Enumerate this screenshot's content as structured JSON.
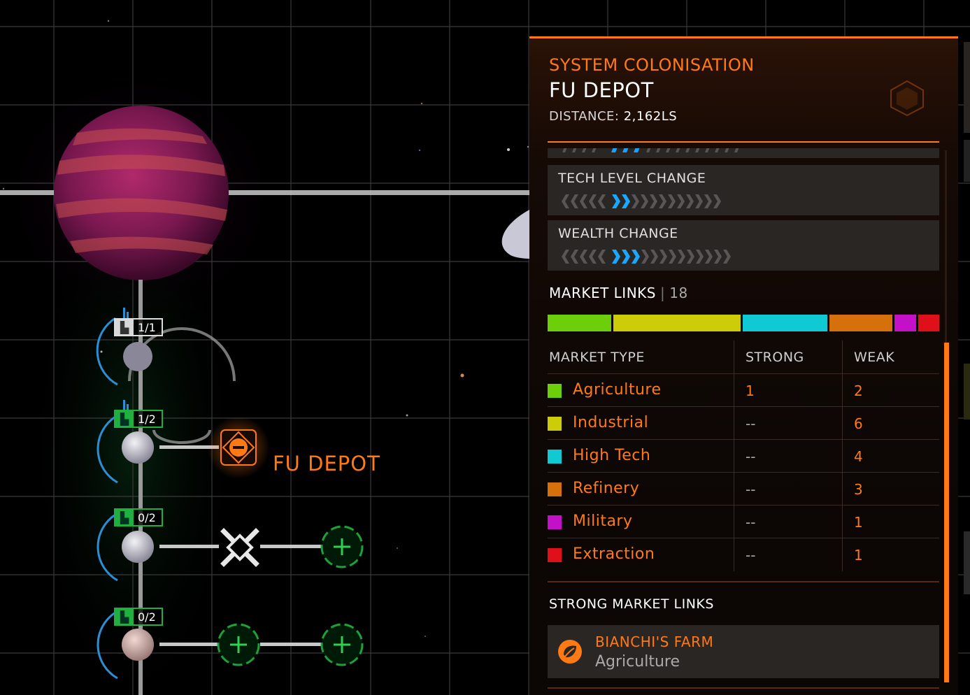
{
  "panel": {
    "label": "SYSTEM COLONISATION",
    "title": "FU DEPOT",
    "distance_label": "DISTANCE:",
    "distance_value": "2,162LS",
    "accent": "#ff7a14"
  },
  "cards": [
    {
      "label": "TECH LEVEL CHANGE",
      "level": 2
    },
    {
      "label": "WEALTH CHANGE",
      "level": 3
    }
  ],
  "market_links": {
    "label": "MARKET LINKS",
    "count": "18",
    "segments": [
      {
        "name": "Agriculture",
        "weight": 3,
        "color": "#6ccf0a"
      },
      {
        "name": "Industrial",
        "weight": 6,
        "color": "#cccc08"
      },
      {
        "name": "High Tech",
        "weight": 4,
        "color": "#0fcad2"
      },
      {
        "name": "Refinery",
        "weight": 3,
        "color": "#d5700c"
      },
      {
        "name": "Military",
        "weight": 1,
        "color": "#c410c8"
      },
      {
        "name": "Extraction",
        "weight": 1,
        "color": "#e0101a"
      }
    ]
  },
  "table": {
    "headers": {
      "type": "MARKET TYPE",
      "strong": "STRONG",
      "weak": "WEAK"
    },
    "rows": [
      {
        "name": "Agriculture",
        "strong": "1",
        "weak": "2",
        "color": "#6ccf0a"
      },
      {
        "name": "Industrial",
        "strong": "--",
        "weak": "6",
        "color": "#cccc08"
      },
      {
        "name": "High Tech",
        "strong": "--",
        "weak": "4",
        "color": "#0fcad2"
      },
      {
        "name": "Refinery",
        "strong": "--",
        "weak": "3",
        "color": "#d5700c"
      },
      {
        "name": "Military",
        "strong": "--",
        "weak": "1",
        "color": "#c410c8"
      },
      {
        "name": "Extraction",
        "strong": "--",
        "weak": "1",
        "color": "#e0101a"
      }
    ]
  },
  "strong_links": {
    "label": "STRONG MARKET LINKS",
    "items": [
      {
        "name": "BIANCHI'S FARM",
        "type": "Agriculture",
        "icon": "leaf-icon"
      }
    ]
  },
  "map": {
    "depot_label": "FU DEPOT",
    "slots": [
      {
        "count": "1/1"
      },
      {
        "count": "1/2"
      },
      {
        "count": "0/2"
      },
      {
        "count": "0/2"
      }
    ]
  }
}
